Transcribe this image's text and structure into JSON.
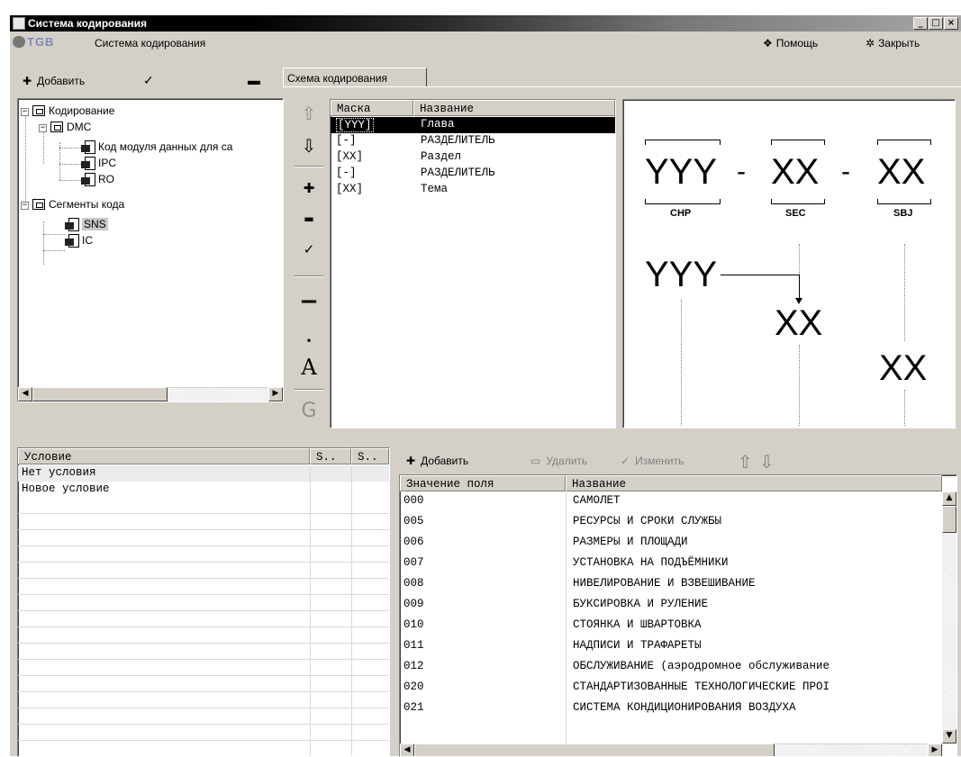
{
  "window": {
    "title": "Система кодирования"
  },
  "menubar": {
    "logo": "TGB",
    "app_label": "Система кодирования",
    "help": "Помощь",
    "close": "Закрыть"
  },
  "tree_toolbar": {
    "add": "Добавить"
  },
  "tree": {
    "root": "Кодирование",
    "dmc": "DMC",
    "dmc_items": [
      "Код модуля данных для са",
      "IPC",
      "RO"
    ],
    "segments": "Сегменты кода",
    "segment_items": [
      "SNS",
      "IC"
    ]
  },
  "tab": {
    "label": "Схема кодирования"
  },
  "mask_table": {
    "headers": [
      "Маска",
      "Название"
    ],
    "rows": [
      [
        "[YYY]",
        "Глава"
      ],
      [
        "[-]",
        "РАЗДЕЛИТЕЛЬ"
      ],
      [
        "[XX]",
        "Раздел"
      ],
      [
        "[-]",
        "РАЗДЕЛИТЕЛЬ"
      ],
      [
        "[XX]",
        "Тема"
      ]
    ]
  },
  "vertical_toolbar": {
    "glyphs": [
      "⇧",
      "⇩",
      "✚",
      "▬",
      "✓",
      "−",
      "•",
      "A",
      "G"
    ]
  },
  "diagram": {
    "segments": [
      "YYY",
      "XX",
      "XX"
    ],
    "separator": "-",
    "captions": [
      "CHP",
      "SEC",
      "SBJ"
    ]
  },
  "condition_table": {
    "headers": [
      "Условие",
      "S..",
      "S.."
    ],
    "rows": [
      "Нет условия",
      "Новое условие"
    ]
  },
  "values_toolbar": {
    "add": "Добавить",
    "delete": "Удалить",
    "edit": "Изменить"
  },
  "values_table": {
    "headers": [
      "Значение поля",
      "Название"
    ],
    "rows": [
      [
        "000",
        "САМОЛЕТ"
      ],
      [
        "005",
        "РЕСУРСЫ И СРОКИ СЛУЖБЫ"
      ],
      [
        "006",
        "РАЗМЕРЫ И ПЛОЩАДИ"
      ],
      [
        "007",
        "УСТАНОВКА НА ПОДЪЁМНИКИ"
      ],
      [
        "008",
        "НИВЕЛИРОВАНИЕ И ВЗВЕШИВАНИЕ"
      ],
      [
        "009",
        "БУКСИРОВКА И РУЛЕНИЕ"
      ],
      [
        "010",
        "СТОЯНКА И ШВАРТОВКА"
      ],
      [
        "011",
        "НАДПИСИ И ТРАФАРЕТЫ"
      ],
      [
        "012",
        "ОБСЛУЖИВАНИЕ (аэродромное обслуживание"
      ],
      [
        "020",
        "СТАНДАРТИЗОВАННЫЕ ТЕХНОЛОГИЧЕСКИЕ ПРОІ"
      ],
      [
        "021",
        "СИСТЕМА КОНДИЦИОНИРОВАНИЯ ВОЗДУХА"
      ]
    ]
  }
}
